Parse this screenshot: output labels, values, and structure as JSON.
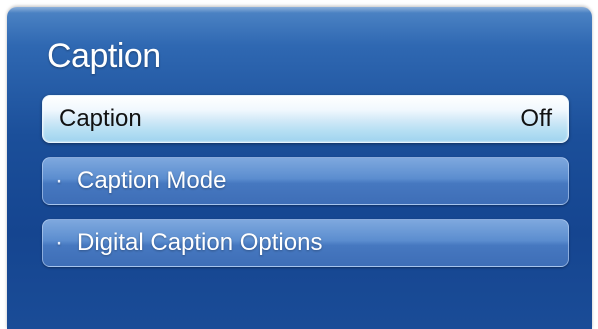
{
  "menu": {
    "title": "Caption",
    "items": [
      {
        "label": "Caption",
        "value": "Off",
        "bullet": ""
      },
      {
        "label": "Caption Mode",
        "value": "",
        "bullet": "·"
      },
      {
        "label": "Digital Caption Options",
        "value": "",
        "bullet": "·"
      }
    ]
  }
}
